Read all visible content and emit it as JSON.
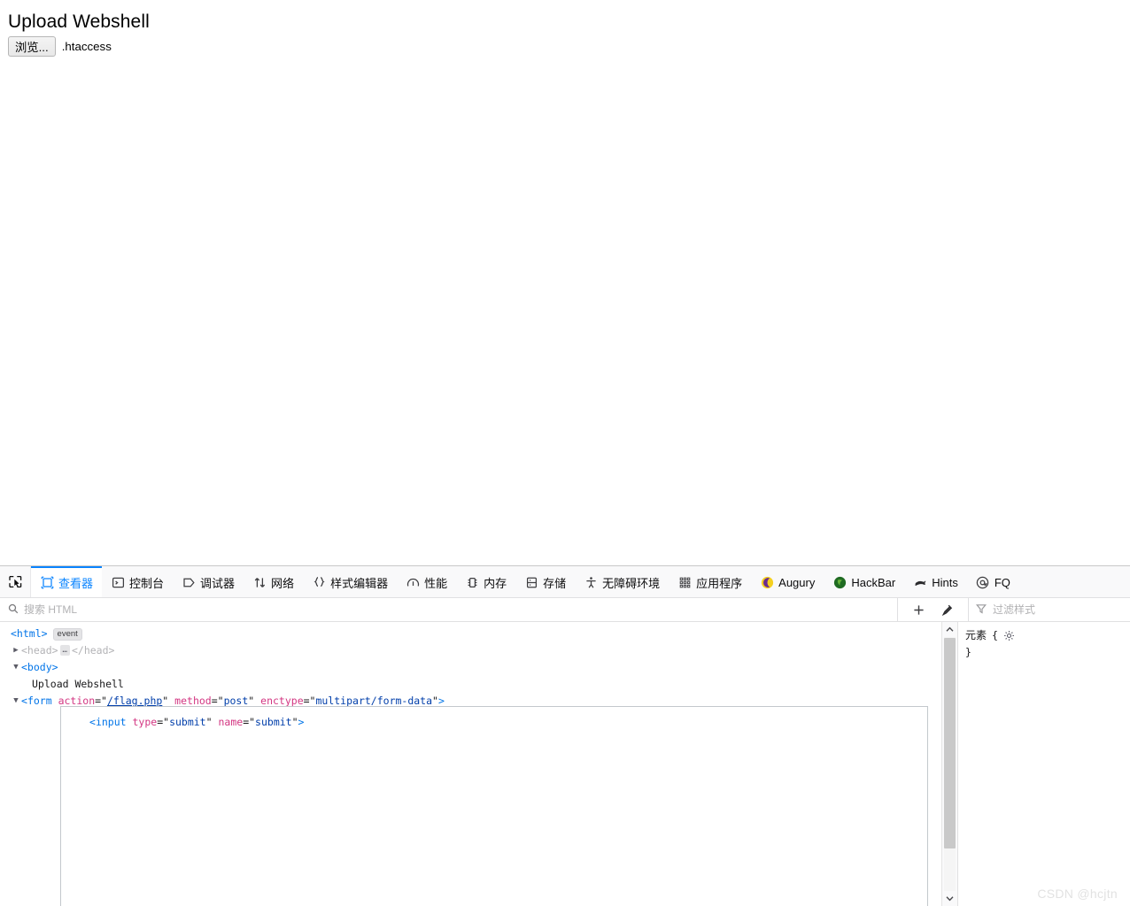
{
  "page": {
    "title": "Upload Webshell",
    "form": {
      "browse_label": "浏览...",
      "file_name": ".htaccess"
    }
  },
  "devtools": {
    "picker_icon": "element-picker-icon",
    "tabs": [
      {
        "label": "查看器",
        "icon": "inspector-icon",
        "active": true
      },
      {
        "label": "控制台",
        "icon": "console-icon",
        "active": false
      },
      {
        "label": "调试器",
        "icon": "debugger-icon",
        "active": false
      },
      {
        "label": "网络",
        "icon": "network-icon",
        "active": false
      },
      {
        "label": "样式编辑器",
        "icon": "style-editor-icon",
        "active": false
      },
      {
        "label": "性能",
        "icon": "performance-icon",
        "active": false
      },
      {
        "label": "内存",
        "icon": "memory-icon",
        "active": false
      },
      {
        "label": "存储",
        "icon": "storage-icon",
        "active": false
      },
      {
        "label": "无障碍环境",
        "icon": "accessibility-icon",
        "active": false
      },
      {
        "label": "应用程序",
        "icon": "application-icon",
        "active": false
      },
      {
        "label": "Augury",
        "icon": "augury-icon",
        "active": false
      },
      {
        "label": "HackBar",
        "icon": "hackbar-icon",
        "active": false
      },
      {
        "label": "Hints",
        "icon": "hints-icon",
        "active": false
      },
      {
        "label": "FQ",
        "icon": "at-sign-icon",
        "active": false
      }
    ],
    "search": {
      "placeholder": "搜索 HTML",
      "value": "",
      "icon": "search-icon"
    },
    "rule_tools": {
      "add_rule_icon": "plus-icon",
      "color_picker_icon": "eyedropper-icon"
    },
    "filter": {
      "placeholder": "过滤样式",
      "value": "",
      "icon": "filter-icon"
    },
    "markup": {
      "nodes": [
        {
          "twisty": "",
          "indent": 0,
          "open": "<html>",
          "badge": "event"
        },
        {
          "twisty": "▶",
          "indent": 1,
          "open": "<head>",
          "ellipsis": "…",
          "close": "</head>"
        },
        {
          "twisty": "▼",
          "indent": 1,
          "open": "<body>"
        },
        {
          "twisty": "",
          "indent": 2,
          "text": "Upload Webshell"
        },
        {
          "twisty": "▼",
          "indent": 1,
          "tag": "form",
          "attrs": [
            {
              "name": "action",
              "value": "/flag.php",
              "link": true
            },
            {
              "name": "method",
              "value": "post",
              "link": false
            },
            {
              "name": "enctype",
              "value": "multipart/form-data",
              "link": false
            }
          ]
        }
      ],
      "selected_node": {
        "tag": "input",
        "attrs": [
          {
            "name": "type",
            "value": "submit"
          },
          {
            "name": "name",
            "value": "submit"
          }
        ]
      }
    },
    "rules": {
      "selector": "元素",
      "open_brace": "{",
      "close_brace": "}",
      "gear_icon": "gear-icon"
    },
    "scrollbar": {
      "up_icon": "chevron-up-icon",
      "down_icon": "chevron-down-icon"
    }
  },
  "watermark": "CSDN @hcjtn",
  "colors": {
    "accent": "#0a84ff",
    "tag": "#0074e8",
    "attr_name": "#d33682",
    "attr_value": "#003eaa",
    "chrome_bg": "#f9f9fa"
  }
}
